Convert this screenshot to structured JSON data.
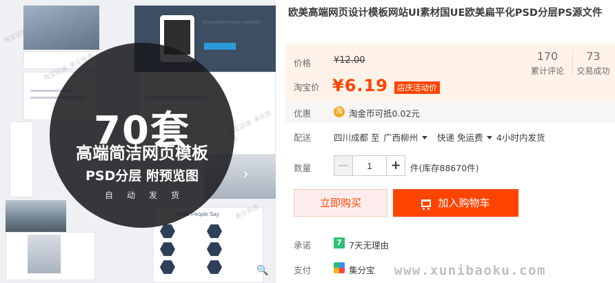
{
  "gallery": {
    "overlay_big": "70套",
    "overlay_line2": "高端简洁网页模板",
    "overlay_line3": "PSD分层 附预览图",
    "overlay_line4": [
      "自",
      "动",
      "发",
      "货"
    ],
    "section_heading": "What People Say",
    "caption": "Quam eleifend metus commodo",
    "next_arrow": "›",
    "zoom_glyph": "🔍",
    "faint_watermarks": [
      "淘宝店铺: 素众资源",
      "淘宝店铺: 素众资源",
      "淘宝店铺: 素众资源",
      "素众资源"
    ]
  },
  "product": {
    "title": "欧美高端网页设计模板网站UI素材国UE欧美扁平化PSD分层PS源文件"
  },
  "price": {
    "label": "价格",
    "original": "¥12.00",
    "taobao_label": "淘宝价",
    "current": "¥6.19",
    "promo_tag": "店庆活动价"
  },
  "stats": {
    "reviews_count": "170",
    "reviews_label": "累计评论",
    "deals_count": "73",
    "deals_label": "交易成功"
  },
  "discount": {
    "label": "优惠",
    "coin_glyph": "淘",
    "text": "淘金币可抵0.02元"
  },
  "delivery": {
    "label": "配送",
    "from": "四川成都 至",
    "to": "广西柳州",
    "method": "快递 免运费",
    "ship_time": "4小时内发货"
  },
  "quantity": {
    "label": "数量",
    "minus": "−",
    "value": "1",
    "plus": "+",
    "stock": "件(库存88670件)"
  },
  "actions": {
    "buy_now": "立即购买",
    "add_to_cart": "加入购物车"
  },
  "promise": {
    "label": "承诺",
    "badge": "7",
    "text": "7天无理由"
  },
  "payment": {
    "label": "支付",
    "text": "集分宝"
  },
  "watermark": "www.xunibaoku.com"
}
